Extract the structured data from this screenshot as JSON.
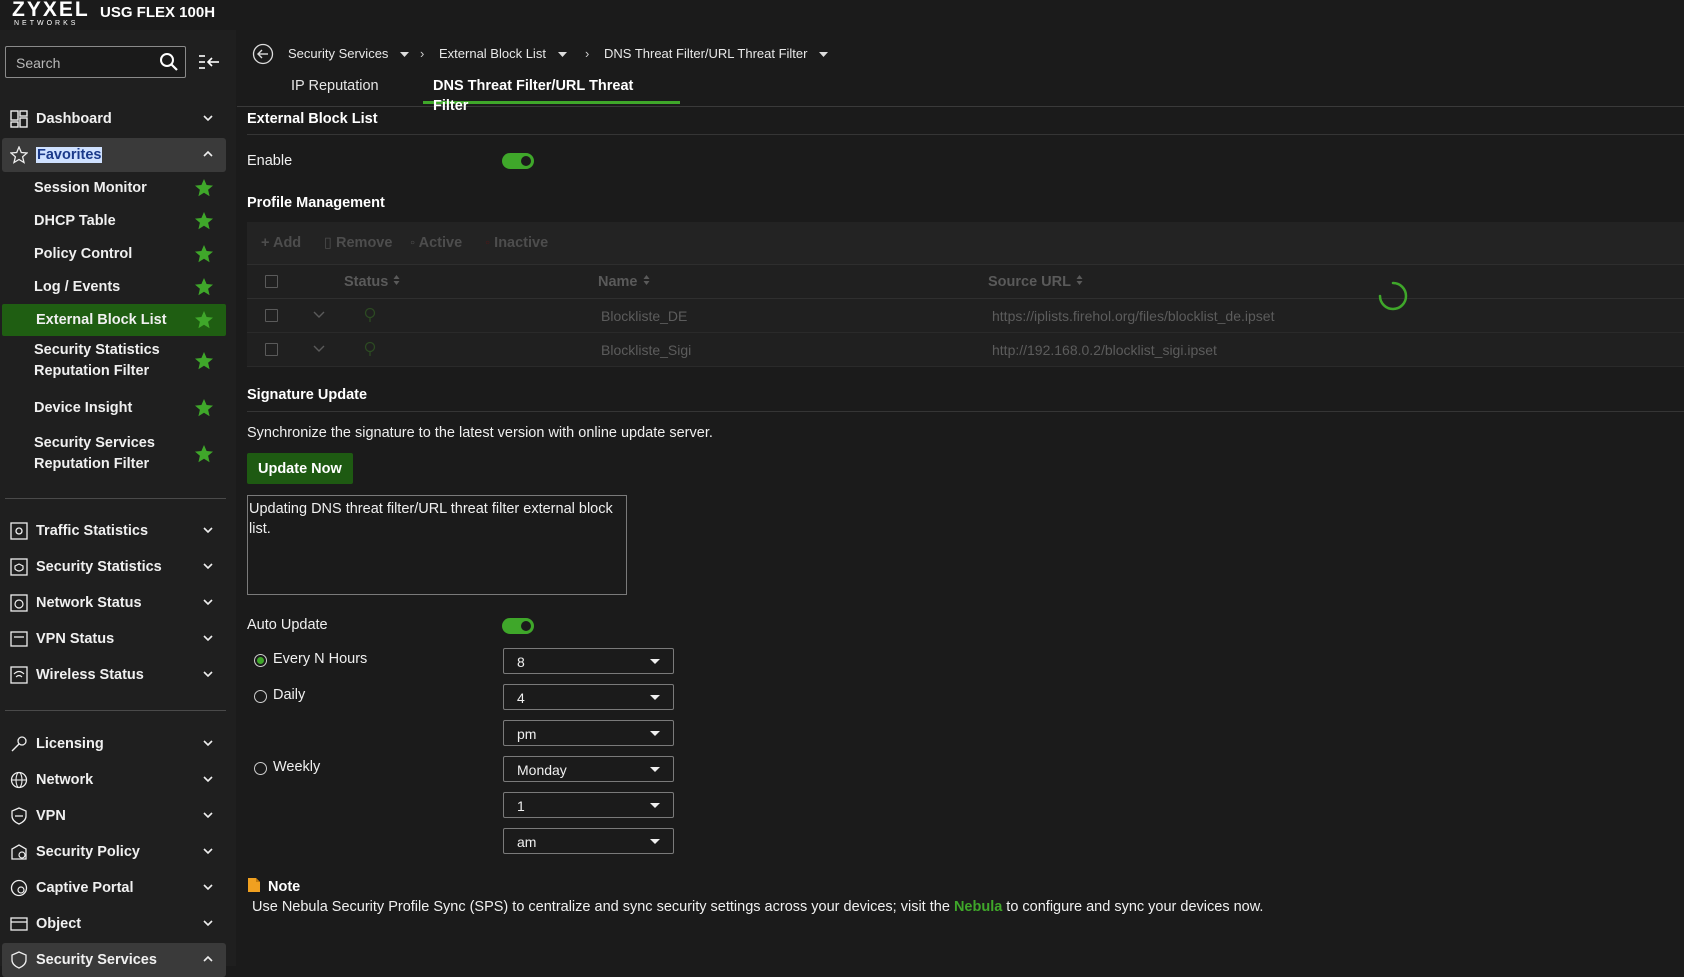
{
  "app": {
    "brand": "ZYXEL",
    "brand_sub": "NETWORKS",
    "model": "USG FLEX 100H",
    "accent_color": "#3fa72a"
  },
  "sidebar": {
    "search_placeholder": "Search",
    "dashboard": "Dashboard",
    "favorites_header": "Favorites",
    "favorites": [
      {
        "label": "Session Monitor",
        "line2": ""
      },
      {
        "label": "DHCP Table",
        "line2": ""
      },
      {
        "label": "Policy Control",
        "line2": ""
      },
      {
        "label": "Log / Events",
        "line2": ""
      },
      {
        "label": "External Block List",
        "line2": "",
        "active": true
      },
      {
        "label": "Security Statistics",
        "line2": "Reputation Filter"
      },
      {
        "label": "Device Insight",
        "line2": ""
      },
      {
        "label": "Security Services",
        "line2": "Reputation Filter"
      }
    ],
    "monitor_items": [
      {
        "label": "Traffic Statistics",
        "icon": "traffic-statistics-icon"
      },
      {
        "label": "Security Statistics",
        "icon": "security-statistics-icon"
      },
      {
        "label": "Network Status",
        "icon": "network-status-icon"
      },
      {
        "label": "VPN Status",
        "icon": "vpn-status-icon"
      },
      {
        "label": "Wireless Status",
        "icon": "wireless-status-icon"
      }
    ],
    "config_items": [
      {
        "label": "Licensing",
        "icon": "key-icon"
      },
      {
        "label": "Network",
        "icon": "globe-icon"
      },
      {
        "label": "VPN",
        "icon": "shield-icon"
      },
      {
        "label": "Security Policy",
        "icon": "security-policy-icon"
      },
      {
        "label": "Captive Portal",
        "icon": "captive-portal-icon"
      },
      {
        "label": "Object",
        "icon": "object-icon"
      },
      {
        "label": "Security Services",
        "icon": "security-services-icon"
      }
    ]
  },
  "breadcrumb": {
    "items": [
      "Security Services",
      "External Block List",
      "DNS Threat Filter/URL Threat Filter"
    ]
  },
  "tabs": [
    "IP Reputation",
    "DNS Threat Filter/URL Threat Filter"
  ],
  "ebl": {
    "title": "External Block List",
    "enable_label": "Enable",
    "enabled": true
  },
  "profile": {
    "title": "Profile Management",
    "toolbar": {
      "add": "Add",
      "remove": "Remove",
      "active": "Active",
      "inactive": "Inactive"
    },
    "columns": {
      "status": "Status",
      "name": "Name",
      "source_url": "Source URL"
    },
    "rows": [
      {
        "name": "Blockliste_DE",
        "url": "https://iplists.firehol.org/files/blocklist_de.ipset"
      },
      {
        "name": "Blockliste_Sigi",
        "url": "http://192.168.0.2/blocklist_sigi.ipset"
      }
    ]
  },
  "signature": {
    "title": "Signature Update",
    "description": "Synchronize the signature to the latest version with online update server.",
    "update_button": "Update Now",
    "log": "Updating DNS threat filter/URL threat filter external block list.",
    "auto_update_label": "Auto Update",
    "auto_update": true,
    "every_n_hours_label": "Every N Hours",
    "every_n_hours_value": "8",
    "daily_label": "Daily",
    "daily_hour": "4",
    "daily_ampm": "pm",
    "weekly_label": "Weekly",
    "weekly_day": "Monday",
    "weekly_hour": "1",
    "weekly_ampm": "am",
    "selected": "every_n_hours"
  },
  "note": {
    "title": "Note",
    "text_before": "Use Nebula Security Profile Sync (SPS) to centralize and sync security settings across your devices; visit the ",
    "link": "Nebula",
    "text_after": " to configure and sync your devices now."
  }
}
